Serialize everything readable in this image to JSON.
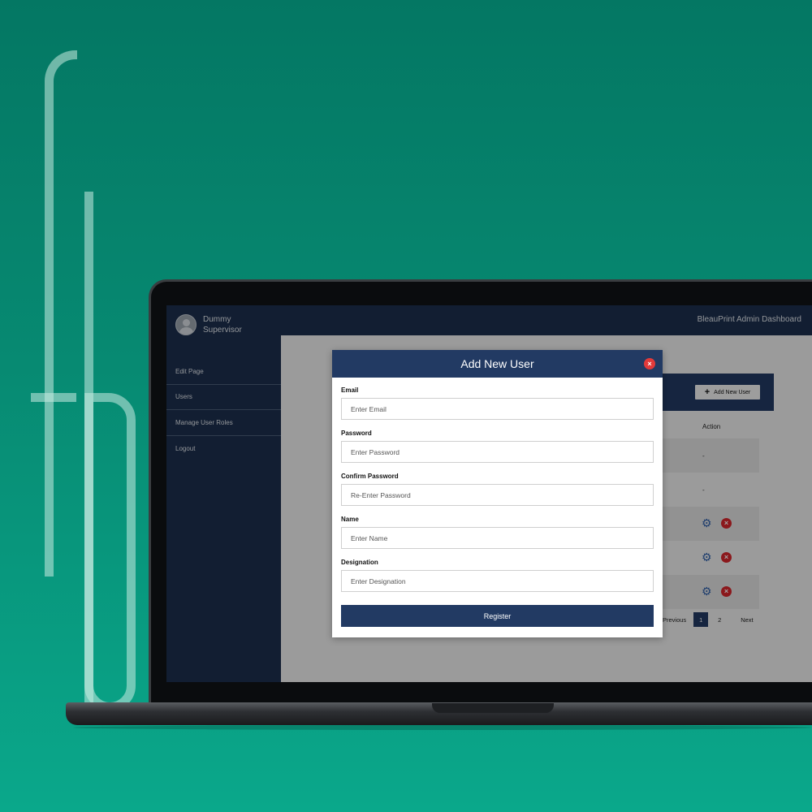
{
  "app": {
    "title": "BleauPrint Admin Dashboard"
  },
  "profile": {
    "name": "Dummy Supervisor"
  },
  "sidebar": {
    "items": [
      {
        "label": "Edit Page"
      },
      {
        "label": "Users"
      },
      {
        "label": "Manage User Roles"
      },
      {
        "label": "Logout"
      }
    ]
  },
  "users_panel": {
    "add_button_label": "Add New User",
    "action_header": "Action",
    "rows": [
      {
        "action": "-"
      },
      {
        "action": "-"
      },
      {
        "action": "icons"
      },
      {
        "action": "icons"
      },
      {
        "action": "icons"
      }
    ],
    "pagination": {
      "previous": "Previous",
      "pages": [
        "1",
        "2"
      ],
      "current": "1",
      "next": "Next"
    }
  },
  "modal": {
    "title": "Add New User",
    "fields": [
      {
        "label": "Email",
        "placeholder": "Enter Email"
      },
      {
        "label": "Password",
        "placeholder": "Enter Password"
      },
      {
        "label": "Confirm Password",
        "placeholder": "Re-Enter Password"
      },
      {
        "label": "Name",
        "placeholder": "Enter Name"
      },
      {
        "label": "Designation",
        "placeholder": "Enter Designation"
      }
    ],
    "submit_label": "Register"
  },
  "colors": {
    "navy": "#1d2f4d",
    "accent_navy": "#223a63",
    "delete_red": "#d6262c",
    "edit_blue": "#2f5fa8",
    "background_teal": "#078a72"
  },
  "icons": {
    "edit": "gear-icon",
    "delete": "close-circle-icon",
    "add": "plus-icon"
  }
}
